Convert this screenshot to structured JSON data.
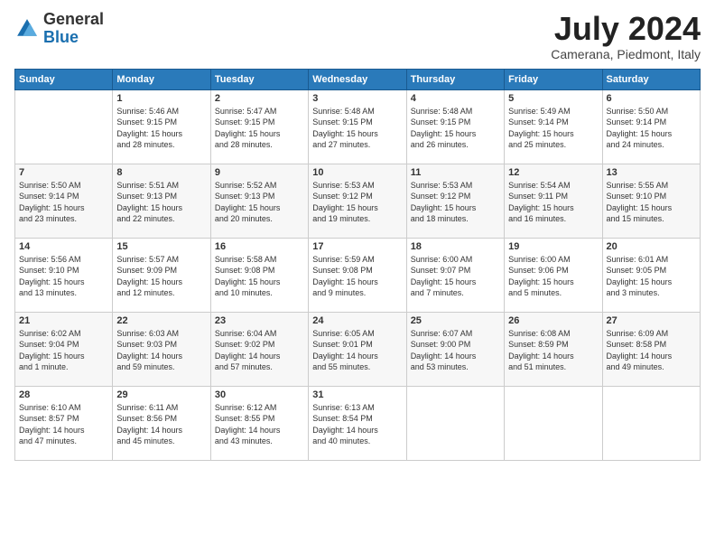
{
  "header": {
    "logo_general": "General",
    "logo_blue": "Blue",
    "month_title": "July 2024",
    "location": "Camerana, Piedmont, Italy"
  },
  "days_of_week": [
    "Sunday",
    "Monday",
    "Tuesday",
    "Wednesday",
    "Thursday",
    "Friday",
    "Saturday"
  ],
  "weeks": [
    [
      {
        "num": "",
        "info": ""
      },
      {
        "num": "1",
        "info": "Sunrise: 5:46 AM\nSunset: 9:15 PM\nDaylight: 15 hours\nand 28 minutes."
      },
      {
        "num": "2",
        "info": "Sunrise: 5:47 AM\nSunset: 9:15 PM\nDaylight: 15 hours\nand 28 minutes."
      },
      {
        "num": "3",
        "info": "Sunrise: 5:48 AM\nSunset: 9:15 PM\nDaylight: 15 hours\nand 27 minutes."
      },
      {
        "num": "4",
        "info": "Sunrise: 5:48 AM\nSunset: 9:15 PM\nDaylight: 15 hours\nand 26 minutes."
      },
      {
        "num": "5",
        "info": "Sunrise: 5:49 AM\nSunset: 9:14 PM\nDaylight: 15 hours\nand 25 minutes."
      },
      {
        "num": "6",
        "info": "Sunrise: 5:50 AM\nSunset: 9:14 PM\nDaylight: 15 hours\nand 24 minutes."
      }
    ],
    [
      {
        "num": "7",
        "info": "Sunrise: 5:50 AM\nSunset: 9:14 PM\nDaylight: 15 hours\nand 23 minutes."
      },
      {
        "num": "8",
        "info": "Sunrise: 5:51 AM\nSunset: 9:13 PM\nDaylight: 15 hours\nand 22 minutes."
      },
      {
        "num": "9",
        "info": "Sunrise: 5:52 AM\nSunset: 9:13 PM\nDaylight: 15 hours\nand 20 minutes."
      },
      {
        "num": "10",
        "info": "Sunrise: 5:53 AM\nSunset: 9:12 PM\nDaylight: 15 hours\nand 19 minutes."
      },
      {
        "num": "11",
        "info": "Sunrise: 5:53 AM\nSunset: 9:12 PM\nDaylight: 15 hours\nand 18 minutes."
      },
      {
        "num": "12",
        "info": "Sunrise: 5:54 AM\nSunset: 9:11 PM\nDaylight: 15 hours\nand 16 minutes."
      },
      {
        "num": "13",
        "info": "Sunrise: 5:55 AM\nSunset: 9:10 PM\nDaylight: 15 hours\nand 15 minutes."
      }
    ],
    [
      {
        "num": "14",
        "info": "Sunrise: 5:56 AM\nSunset: 9:10 PM\nDaylight: 15 hours\nand 13 minutes."
      },
      {
        "num": "15",
        "info": "Sunrise: 5:57 AM\nSunset: 9:09 PM\nDaylight: 15 hours\nand 12 minutes."
      },
      {
        "num": "16",
        "info": "Sunrise: 5:58 AM\nSunset: 9:08 PM\nDaylight: 15 hours\nand 10 minutes."
      },
      {
        "num": "17",
        "info": "Sunrise: 5:59 AM\nSunset: 9:08 PM\nDaylight: 15 hours\nand 9 minutes."
      },
      {
        "num": "18",
        "info": "Sunrise: 6:00 AM\nSunset: 9:07 PM\nDaylight: 15 hours\nand 7 minutes."
      },
      {
        "num": "19",
        "info": "Sunrise: 6:00 AM\nSunset: 9:06 PM\nDaylight: 15 hours\nand 5 minutes."
      },
      {
        "num": "20",
        "info": "Sunrise: 6:01 AM\nSunset: 9:05 PM\nDaylight: 15 hours\nand 3 minutes."
      }
    ],
    [
      {
        "num": "21",
        "info": "Sunrise: 6:02 AM\nSunset: 9:04 PM\nDaylight: 15 hours\nand 1 minute."
      },
      {
        "num": "22",
        "info": "Sunrise: 6:03 AM\nSunset: 9:03 PM\nDaylight: 14 hours\nand 59 minutes."
      },
      {
        "num": "23",
        "info": "Sunrise: 6:04 AM\nSunset: 9:02 PM\nDaylight: 14 hours\nand 57 minutes."
      },
      {
        "num": "24",
        "info": "Sunrise: 6:05 AM\nSunset: 9:01 PM\nDaylight: 14 hours\nand 55 minutes."
      },
      {
        "num": "25",
        "info": "Sunrise: 6:07 AM\nSunset: 9:00 PM\nDaylight: 14 hours\nand 53 minutes."
      },
      {
        "num": "26",
        "info": "Sunrise: 6:08 AM\nSunset: 8:59 PM\nDaylight: 14 hours\nand 51 minutes."
      },
      {
        "num": "27",
        "info": "Sunrise: 6:09 AM\nSunset: 8:58 PM\nDaylight: 14 hours\nand 49 minutes."
      }
    ],
    [
      {
        "num": "28",
        "info": "Sunrise: 6:10 AM\nSunset: 8:57 PM\nDaylight: 14 hours\nand 47 minutes."
      },
      {
        "num": "29",
        "info": "Sunrise: 6:11 AM\nSunset: 8:56 PM\nDaylight: 14 hours\nand 45 minutes."
      },
      {
        "num": "30",
        "info": "Sunrise: 6:12 AM\nSunset: 8:55 PM\nDaylight: 14 hours\nand 43 minutes."
      },
      {
        "num": "31",
        "info": "Sunrise: 6:13 AM\nSunset: 8:54 PM\nDaylight: 14 hours\nand 40 minutes."
      },
      {
        "num": "",
        "info": ""
      },
      {
        "num": "",
        "info": ""
      },
      {
        "num": "",
        "info": ""
      }
    ]
  ]
}
